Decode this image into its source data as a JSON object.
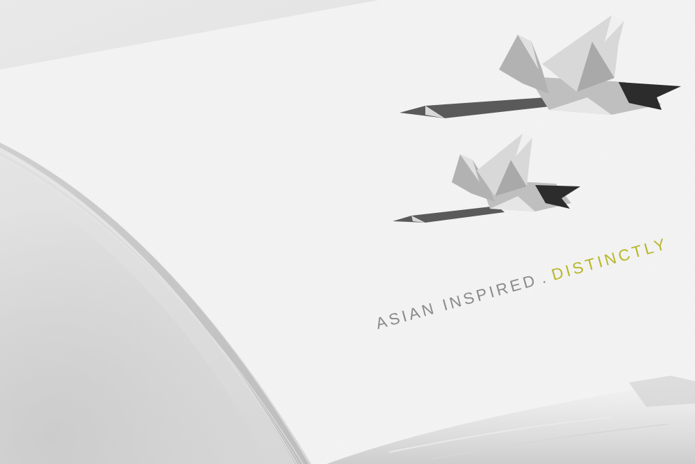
{
  "tagline": {
    "part1": "ASIAN INSPIRED",
    "separator": ".",
    "part2": "DISTINCTLY",
    "part1_color": "#8a8a8a",
    "part2_color": "#b7b728"
  },
  "illustration": {
    "subject": "two origami cranes in flight",
    "count": 2
  },
  "colors": {
    "background": "#dcdcdc",
    "paper": "#f3f3f3",
    "accent": "#b7b728"
  }
}
